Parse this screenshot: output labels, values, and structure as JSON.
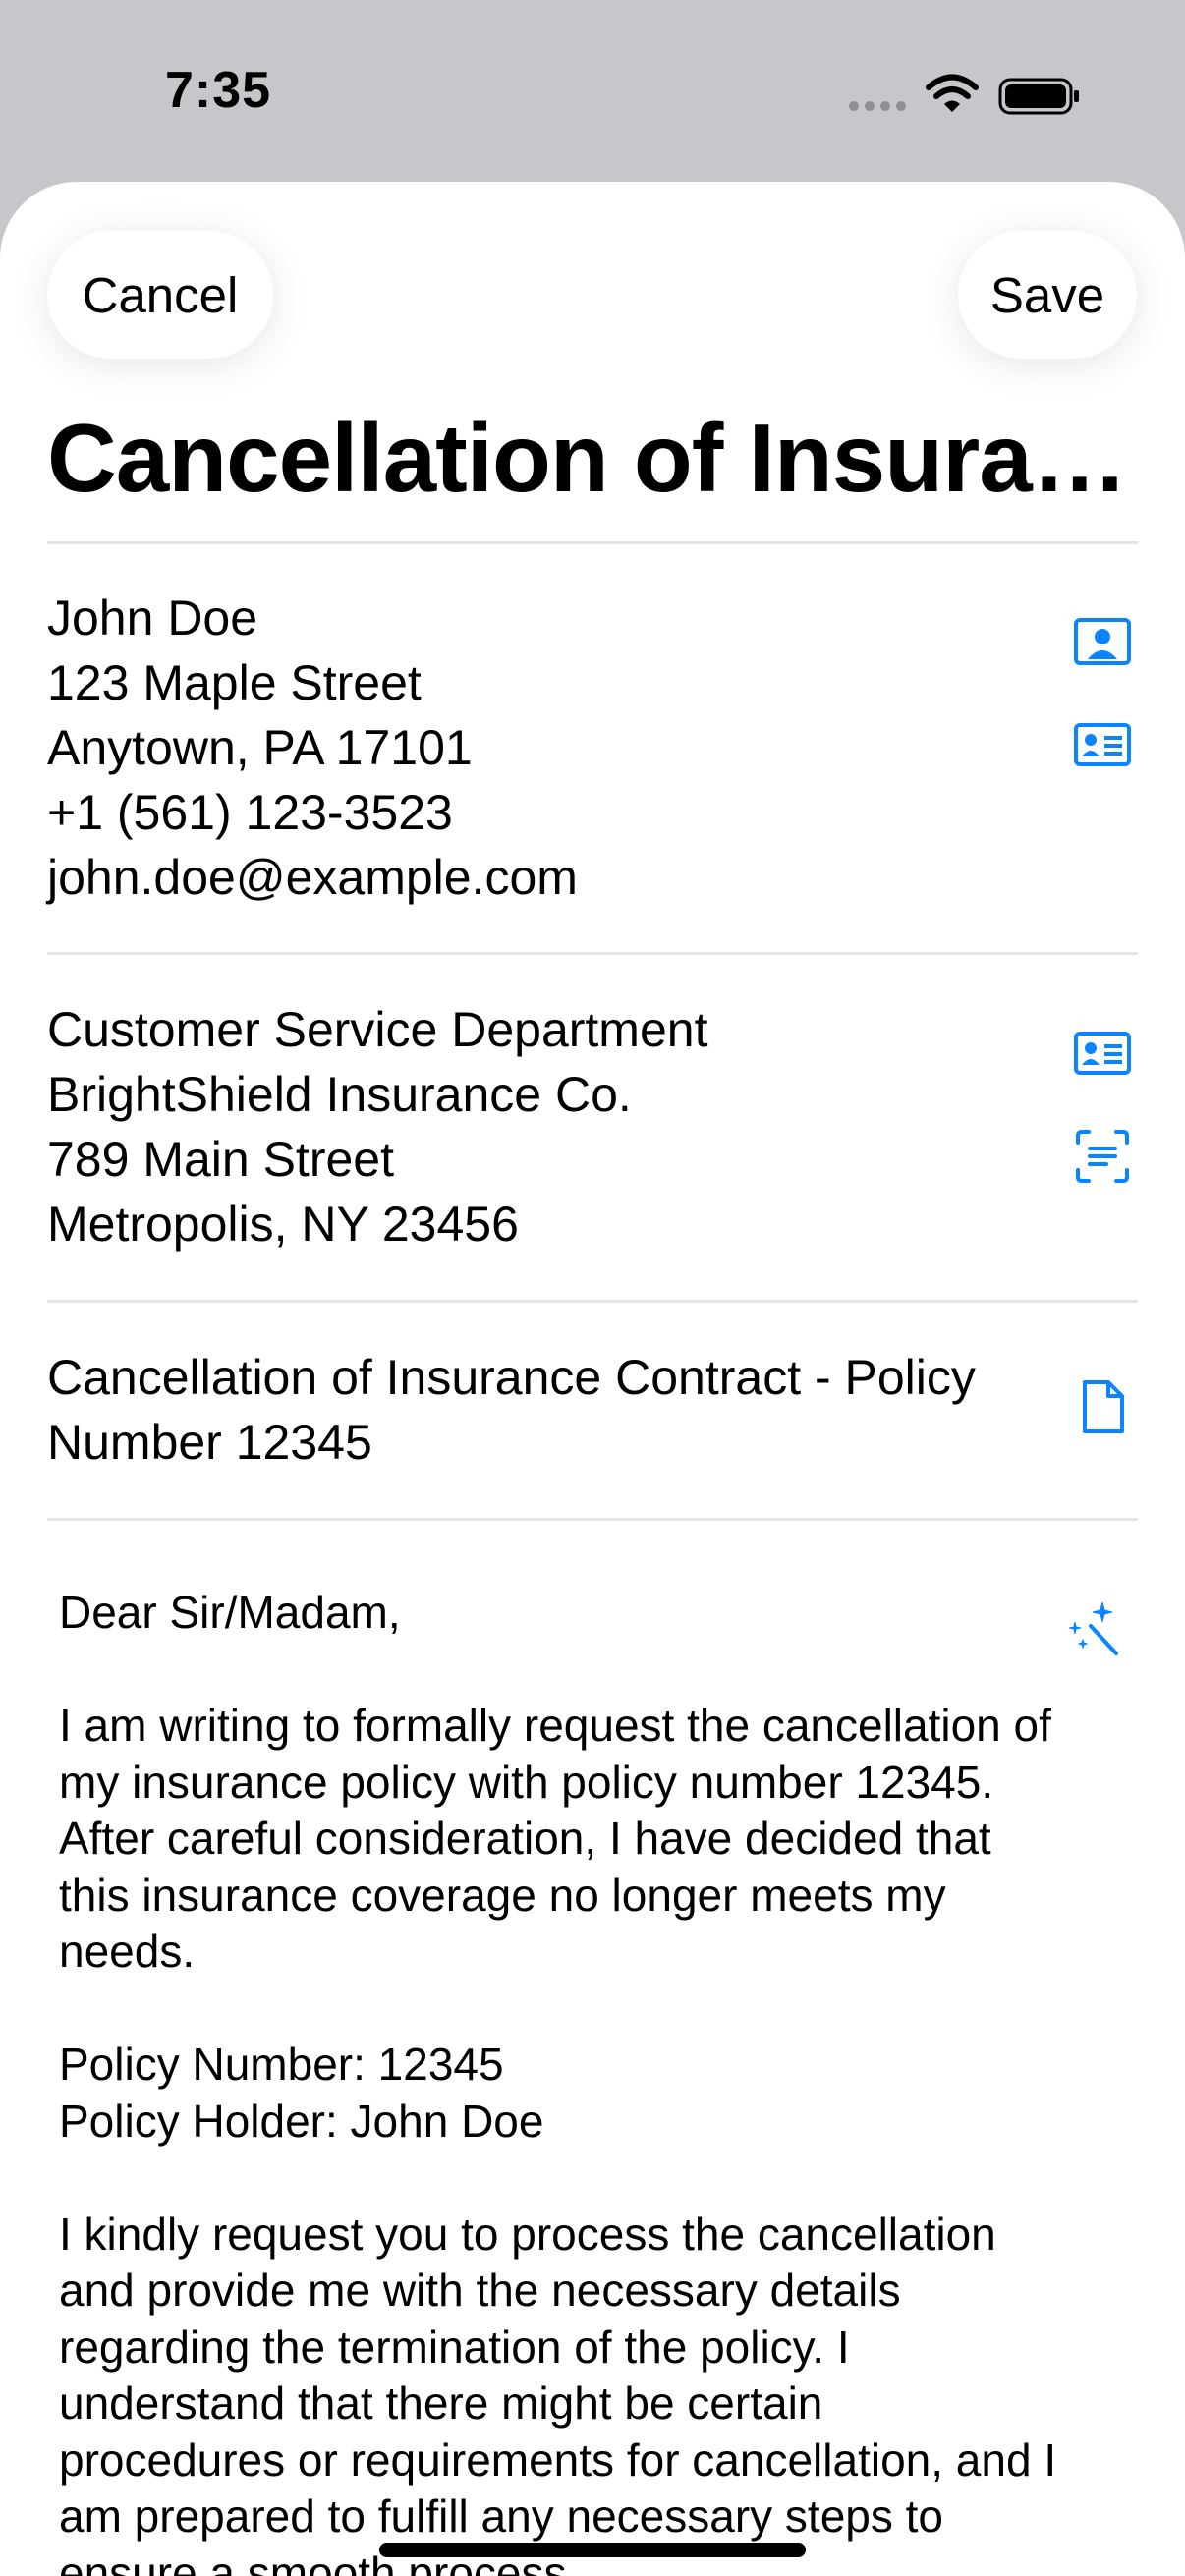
{
  "status_bar": {
    "time": "7:35"
  },
  "toolbar": {
    "cancel_label": "Cancel",
    "save_label": "Save"
  },
  "letter": {
    "title": "Cancellation of Insurance Contract",
    "sender": [
      "John Doe",
      "123 Maple Street",
      "Anytown, PA 17101",
      "+1 (561) 123-3523",
      "john.doe@example.com"
    ],
    "recipient": [
      "Customer Service Department",
      "BrightShield Insurance Co.",
      "789 Main Street",
      "Metropolis, NY 23456"
    ],
    "subject": [
      "Cancellation of Insurance Contract - Policy",
      "Number 12345"
    ],
    "body": [
      "Dear Sir/Madam,",
      "I am writing to formally request the cancellation of\nmy insurance policy with policy number 12345.\nAfter careful consideration, I have decided that\nthis insurance coverage no longer meets my\nneeds.",
      "Policy Number: 12345\nPolicy Holder: John Doe",
      "I kindly request you to process the cancellation\nand provide me with the necessary details\nregarding the termination of the policy. I\nunderstand that there might be certain\nprocedures or requirements for cancellation, and I\nam prepared to fulfill any necessary steps to\nensure a smooth process."
    ]
  },
  "icons": {
    "accent_color": "#0a84ff",
    "sender_icons": [
      "contact-photo-icon",
      "contact-card-icon"
    ],
    "recipient_icons": [
      "contact-card-icon",
      "text-scan-icon"
    ],
    "subject_icon": "document-icon",
    "body_icon": "magic-wand-icon"
  }
}
